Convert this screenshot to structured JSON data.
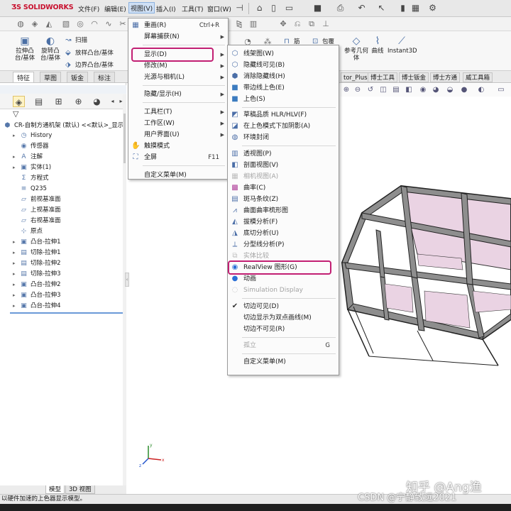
{
  "app": {
    "logo_text": "SOLIDWORKS",
    "menus": [
      "文件(F)",
      "编辑(E)",
      "视图(V)",
      "插入(I)",
      "工具(T)",
      "窗口(W)"
    ]
  },
  "command_manager": {
    "big_tools": [
      {
        "label": "拉伸凸台/基体",
        "icon": "extrude-icon"
      },
      {
        "label": "旋转凸台/基体",
        "icon": "revolve-icon"
      }
    ],
    "row_tools": [
      {
        "label": "扫描",
        "icon": "sweep-icon"
      },
      {
        "label": "放样凸台/基体",
        "icon": "loft-icon"
      },
      {
        "label": "边界凸台/基体",
        "icon": "boundary-icon"
      }
    ],
    "right_tools": [
      {
        "label": "筋",
        "icon": "rib-icon"
      },
      {
        "label": "包覆",
        "icon": "wrap-icon"
      },
      {
        "label": "参考几何体",
        "icon": "reference-geometry-icon"
      },
      {
        "label": "曲线",
        "icon": "curves-icon"
      },
      {
        "label": "Instant3D",
        "icon": "instant3d-icon"
      }
    ]
  },
  "tabs": [
    "特征",
    "草图",
    "钣金",
    "标注"
  ],
  "right_tabs": [
    "tor_Plus",
    "博士工具",
    "博士钣金",
    "博士方通",
    "威工具箱"
  ],
  "feature_tree": {
    "root": "CR-自制方通机架 (默认) <<默认>_显示",
    "items": [
      {
        "label": "History",
        "icon": "history-icon",
        "expandable": true
      },
      {
        "label": "传感器",
        "icon": "sensor-icon",
        "expandable": false
      },
      {
        "label": "注解",
        "icon": "annotation-icon",
        "expandable": true
      },
      {
        "label": "实体(1)",
        "icon": "solid-body-icon",
        "expandable": true
      },
      {
        "label": "方程式",
        "icon": "equation-icon",
        "expandable": false
      },
      {
        "label": "Q235",
        "icon": "material-icon",
        "expandable": false
      },
      {
        "label": "前视基准面",
        "icon": "plane-icon",
        "expandable": false
      },
      {
        "label": "上视基准面",
        "icon": "plane-icon",
        "expandable": false
      },
      {
        "label": "右视基准面",
        "icon": "plane-icon",
        "expandable": false
      },
      {
        "label": "原点",
        "icon": "origin-icon",
        "expandable": false
      },
      {
        "label": "凸台-拉伸1",
        "icon": "extrude-feature-icon",
        "expandable": true
      },
      {
        "label": "切除-拉伸1",
        "icon": "cut-feature-icon",
        "expandable": true
      },
      {
        "label": "切除-拉伸2",
        "icon": "cut-feature-icon",
        "expandable": true
      },
      {
        "label": "切除-拉伸3",
        "icon": "cut-feature-icon",
        "expandable": true
      },
      {
        "label": "凸台-拉伸2",
        "icon": "extrude-feature-icon",
        "expandable": true
      },
      {
        "label": "凸台-拉伸3",
        "icon": "extrude-feature-icon",
        "expandable": true
      },
      {
        "label": "凸台-拉伸4",
        "icon": "extrude-feature-icon",
        "expandable": true
      }
    ]
  },
  "view_menu": {
    "items": [
      {
        "label": "重画(R)",
        "shortcut": "Ctrl+R",
        "icon": "redraw-icon"
      },
      {
        "label": "屏幕捕获(N)",
        "submenu": true
      },
      {
        "label": "显示(D)",
        "submenu": true,
        "highlighted": true
      },
      {
        "label": "修改(M)",
        "submenu": true
      },
      {
        "label": "光源与相机(L)",
        "submenu": true
      },
      {
        "label": "隐藏/显示(H)",
        "submenu": true
      },
      {
        "label": "工具栏(T)",
        "submenu": true
      },
      {
        "label": "工作区(W)",
        "submenu": true
      },
      {
        "label": "用户界面(U)",
        "submenu": true
      },
      {
        "label": "触摸模式",
        "icon": "touch-mode-icon"
      },
      {
        "label": "全屏",
        "shortcut": "F11",
        "icon": "fullscreen-icon"
      },
      {
        "label": "自定义菜单(M)"
      }
    ]
  },
  "display_menu": {
    "items": [
      {
        "label": "线架图(W)",
        "icon": "wireframe-icon"
      },
      {
        "label": "隐藏线可见(B)",
        "icon": "hidden-lines-visible-icon"
      },
      {
        "label": "消除隐藏线(H)",
        "icon": "hidden-lines-removed-icon"
      },
      {
        "label": "带边线上色(E)",
        "icon": "shaded-with-edges-icon"
      },
      {
        "label": "上色(S)",
        "icon": "shaded-icon"
      },
      {
        "label": "草稿品质 HLR/HLV(F)",
        "icon": "draft-quality-icon"
      },
      {
        "label": "在上色模式下加阴影(A)",
        "icon": "shadows-icon"
      },
      {
        "label": "环境封闭",
        "icon": "ambient-occlusion-icon"
      },
      {
        "label": "透视图(P)",
        "icon": "perspective-icon"
      },
      {
        "label": "剖面视图(V)",
        "icon": "section-view-icon"
      },
      {
        "label": "相机视图(A)",
        "icon": "camera-view-icon",
        "disabled": true
      },
      {
        "label": "曲率(C)",
        "icon": "curvature-icon"
      },
      {
        "label": "斑马条纹(Z)",
        "icon": "zebra-stripes-icon"
      },
      {
        "label": "曲面曲率梳形图",
        "icon": "curvature-comb-icon"
      },
      {
        "label": "拔模分析(F)",
        "icon": "draft-analysis-icon"
      },
      {
        "label": "底切分析(U)",
        "icon": "undercut-analysis-icon"
      },
      {
        "label": "分型线分析(P)",
        "icon": "parting-line-icon"
      },
      {
        "label": "实体比较",
        "icon": "compare-icon",
        "disabled": true
      },
      {
        "label": "RealView 图形(G)",
        "icon": "realview-icon",
        "highlighted": true
      },
      {
        "label": "动画",
        "icon": "animation-icon"
      },
      {
        "label": "Simulation Display",
        "icon": "simulation-icon",
        "disabled": true
      },
      {
        "label": "切边可见(D)",
        "icon": "check-icon",
        "checked": true
      },
      {
        "label": "切边显示为双点画线(M)"
      },
      {
        "label": "切边不可见(R)"
      },
      {
        "label": "孤立",
        "shortcut": "G",
        "disabled": true
      },
      {
        "label": "自定义菜单(M)"
      }
    ]
  },
  "bottom_tabs": [
    "模型",
    "3D 视图"
  ],
  "status": "以硬件加速的上色器显示模型。",
  "watermarks": {
    "zhihu": "知乎 @Ang渔",
    "csdn": "CSDN @宁静致远2021"
  },
  "colors": {
    "highlight_box": "#c21f73",
    "model_face": "#8e8e8e",
    "model_pink": "#ead3e3",
    "logo": "#c8102e"
  }
}
